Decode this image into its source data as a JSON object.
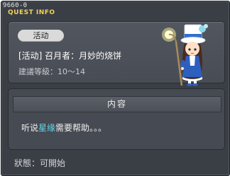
{
  "window": {
    "quest_id": "9660-0",
    "title": "QUEST INFO"
  },
  "quest": {
    "category_badge": "活动",
    "name": "[活动] 召月者：月妙的烧饼",
    "level_label": "建議等級：",
    "level_range": "10～14"
  },
  "npc": {
    "icon": "npc-wizard-girl-with-staff"
  },
  "content": {
    "header": "内容",
    "text_before": "听说",
    "text_highlight": "星缘",
    "text_after": "需要帮助。。。"
  },
  "status": {
    "label": "狀態：",
    "value": "可開始"
  },
  "colors": {
    "title": "#f2d35a",
    "highlight": "#63d7e8",
    "window_bg": "#3a3e45"
  }
}
